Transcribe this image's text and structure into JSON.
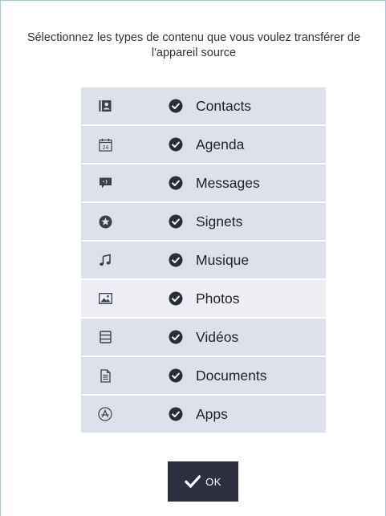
{
  "instruction": "Sélectionnez les types de contenu que vous voulez transférer de l'appareil source",
  "items": [
    {
      "label": "Contacts",
      "icon": "contact-card-icon",
      "checked": true
    },
    {
      "label": "Agenda",
      "icon": "calendar-icon",
      "calendar_day": "24",
      "checked": true
    },
    {
      "label": "Messages",
      "icon": "message-bubble-icon",
      "checked": true
    },
    {
      "label": "Signets",
      "icon": "star-circle-icon",
      "checked": true
    },
    {
      "label": "Musique",
      "icon": "music-note-icon",
      "checked": true
    },
    {
      "label": "Photos",
      "icon": "image-icon",
      "checked": true,
      "highlighted": true
    },
    {
      "label": "Vidéos",
      "icon": "film-strip-icon",
      "checked": true
    },
    {
      "label": "Documents",
      "icon": "document-icon",
      "checked": true
    },
    {
      "label": "Apps",
      "icon": "app-store-icon",
      "checked": true
    }
  ],
  "ok_button": {
    "label": "OK"
  },
  "colors": {
    "row_bg": "#dde1e9",
    "row_bg_highlight": "#eceef3",
    "button_bg": "#2c3040",
    "icon": "#3a3f4e",
    "border": "#a9c3e3"
  }
}
